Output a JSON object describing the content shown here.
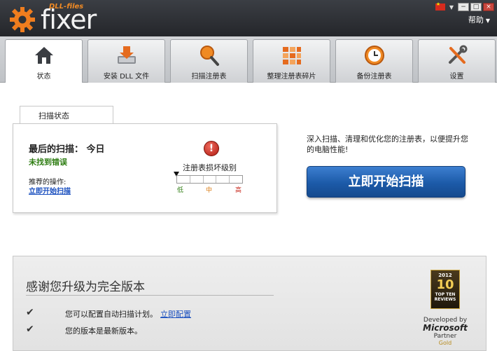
{
  "header": {
    "logo_small": "DLL-files",
    "logo_word": "fixer",
    "help_label": "帮助",
    "window_controls": [
      "−",
      "□",
      "×"
    ]
  },
  "tabs": [
    {
      "label": "状态",
      "icon": "home-icon",
      "active": true
    },
    {
      "label": "安装 DLL 文件",
      "icon": "install-icon",
      "active": false
    },
    {
      "label": "扫描注册表",
      "icon": "magnifier-icon",
      "active": false
    },
    {
      "label": "整理注册表碎片",
      "icon": "defrag-icon",
      "active": false
    },
    {
      "label": "备份注册表",
      "icon": "clock-icon",
      "active": false
    },
    {
      "label": "设置",
      "icon": "tools-icon",
      "active": false
    }
  ],
  "scan_status": {
    "tab_label": "扫描状态",
    "last_scan": "最后的扫描： 今日",
    "result": "未找到错误",
    "recommended_label": "推荐的操作:",
    "recommended_link": "立即开始扫描",
    "severity_label": "注册表损坏级别",
    "levels": [
      "低",
      "中",
      "高"
    ]
  },
  "promo": {
    "text": "深入扫描、清理和优化您的注册表，以便提升您的电脑性能!",
    "button": "立即开始扫描"
  },
  "upgrade": {
    "title": "感谢您升级为完全版本",
    "feature1": "您可以配置自动扫描计划。",
    "feature1_link": "立即配置",
    "feature2": "您的版本是最新版本。"
  },
  "award": {
    "top": "2012",
    "number": "10",
    "bottom": "TOP TEN REVIEWS"
  },
  "partner": {
    "line1": "Developed by",
    "line2": "Microsoft",
    "line3": "Partner",
    "line4": "Gold"
  },
  "colors": {
    "accent_blue": "#1c5aa8",
    "link": "#1a4fbf",
    "success": "#2e7d12",
    "brand_orange": "#f08a24"
  }
}
